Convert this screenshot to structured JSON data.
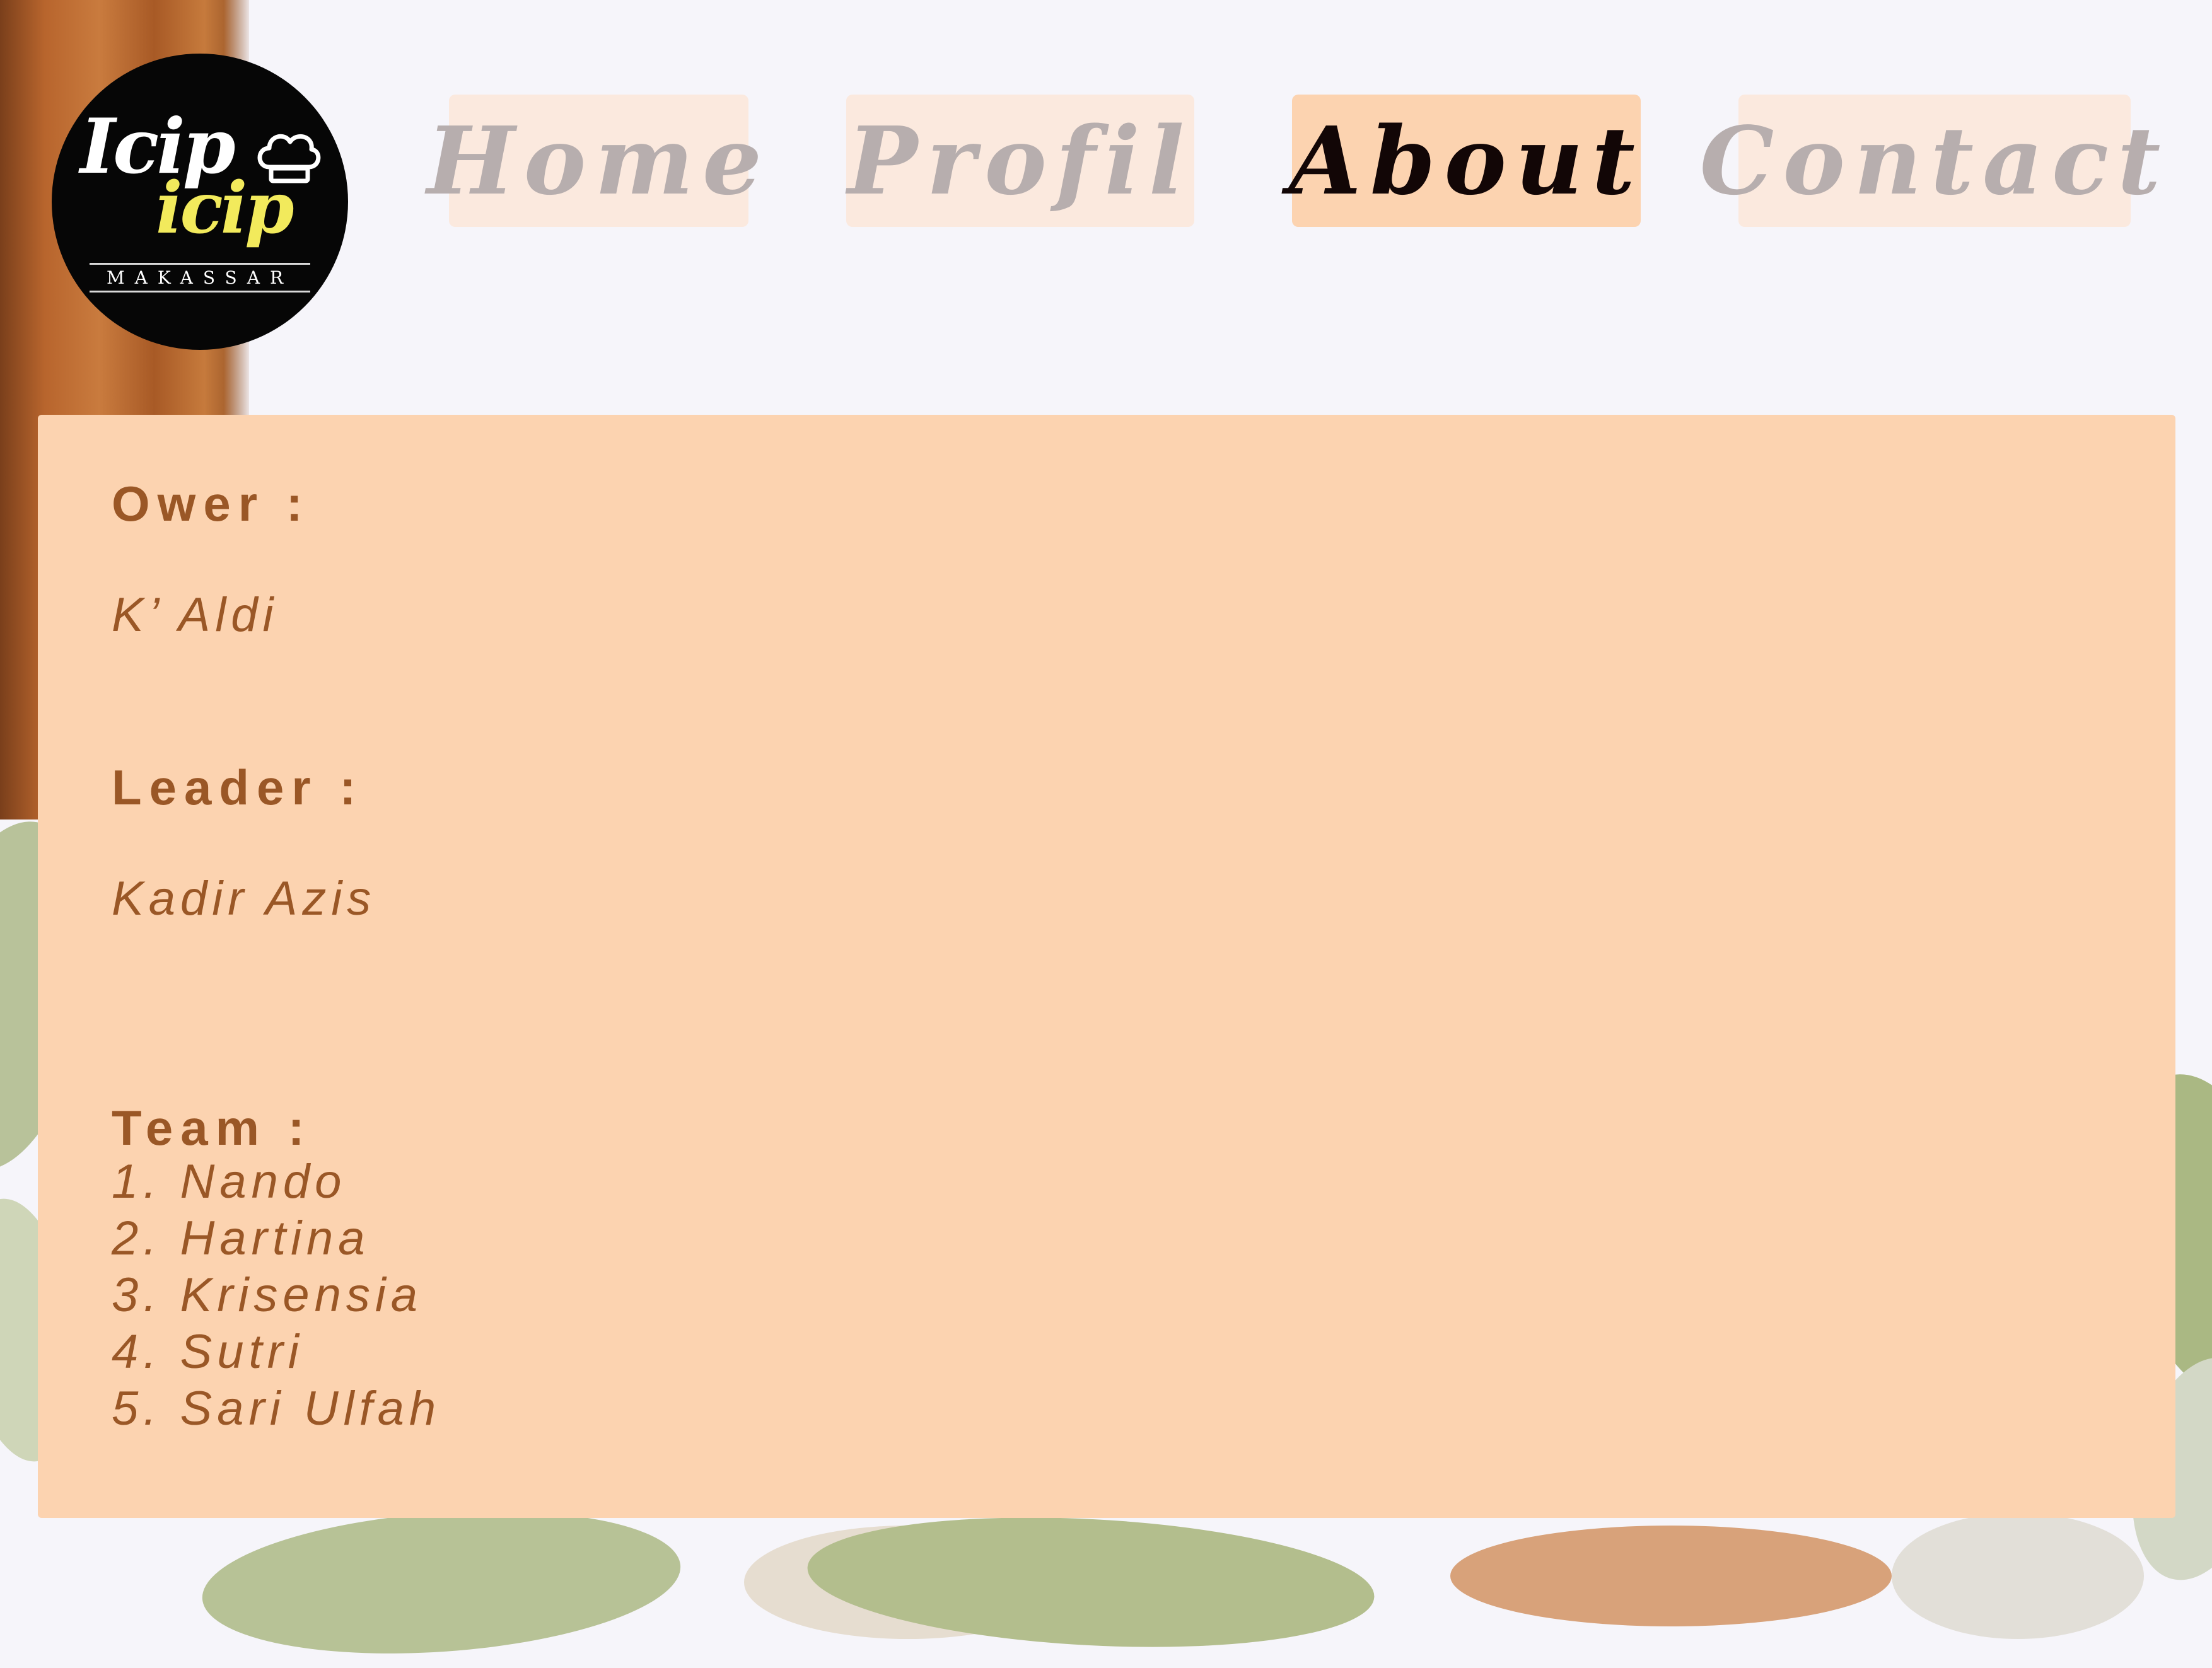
{
  "logo": {
    "line1": "Icip",
    "line2": "icip",
    "subtitle": "MAKASSAR"
  },
  "nav": {
    "items": [
      {
        "label": "Home"
      },
      {
        "label": "Profil"
      },
      {
        "label": "About"
      },
      {
        "label": "Contact"
      }
    ],
    "active": "About"
  },
  "about": {
    "owner": {
      "heading": "Ower :",
      "value": "K’ Aldi"
    },
    "leader": {
      "heading": "Leader :",
      "value": "Kadir Azis"
    },
    "team": {
      "heading": "Team :",
      "members": [
        "1. Nando",
        "2. Hartina",
        "3. Krisensia",
        "4. Sutri",
        "5. Sari Ulfah"
      ]
    }
  },
  "colors": {
    "panel": "#fcd3b0",
    "text": "#9a5726",
    "nav_inactive_bg": "#fbe9de",
    "nav_inactive_text": "#b7aeae",
    "nav_active_text": "#120606",
    "logo_bg": "#060606",
    "logo_accent": "#f2ea5c"
  }
}
